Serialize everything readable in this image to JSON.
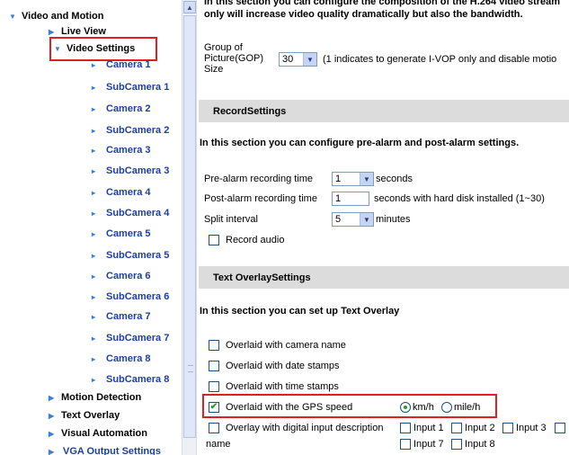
{
  "nav": {
    "video_and_motion": "Video and Motion",
    "live_view": "Live View",
    "video_settings": "Video Settings",
    "cameras": [
      "Camera 1",
      "SubCamera 1",
      "Camera 2",
      "SubCamera 2",
      "Camera 3",
      "SubCamera 3",
      "Camera 4",
      "SubCamera 4",
      "Camera 5",
      "SubCamera 5",
      "Camera 6",
      "SubCamera 6",
      "Camera 7",
      "SubCamera 7",
      "Camera 8",
      "SubCamera 8"
    ],
    "motion_detection": "Motion Detection",
    "text_overlay": "Text Overlay",
    "visual_automation": "Visual Automation",
    "vga_output_settings": "VGA Output Settings"
  },
  "main": {
    "intro_line1": "In this section you can configure the composition of the H.264 video stream",
    "intro_line2": "only will increase video quality dramatically but also the bandwidth.",
    "gop": {
      "label_line1": "Group of",
      "label_line2": "Picture(GOP)",
      "label_line3": "Size",
      "value": "30",
      "hint": "(1 indicates to generate I-VOP only and disable motio"
    },
    "record_settings": {
      "header": "RecordSettings",
      "description": "In this section you can configure pre-alarm and post-alarm settings.",
      "pre_alarm_label": "Pre-alarm recording time",
      "pre_alarm_value": "1",
      "pre_alarm_unit": "seconds",
      "post_alarm_label": "Post-alarm recording time",
      "post_alarm_value": "1",
      "post_alarm_unit": "seconds with hard disk installed (1~30)",
      "split_label": "Split interval",
      "split_value": "5",
      "split_unit": "minutes",
      "record_audio_label": "Record audio",
      "record_audio_checked": false
    },
    "text_overlay": {
      "header": "Text OverlaySettings",
      "description": "In this section you can set up Text Overlay",
      "camera_name_label": "Overlaid with camera name",
      "date_stamps_label": "Overlaid with date stamps",
      "time_stamps_label": "Overlaid with time stamps",
      "gps_speed_label": "Overlaid with the GPS speed",
      "gps_speed_checked": true,
      "unit_kmh": "km/h",
      "unit_mileh": "mile/h",
      "selected_unit": "km/h",
      "digital_input_label_line1": "Overlay with digital input description",
      "digital_input_label_line2": "name",
      "inputs_row1": [
        "Input 1",
        "Input 2",
        "Input 3"
      ],
      "inputs_row2": [
        "Input 7",
        "Input 8"
      ]
    }
  },
  "colors": {
    "highlight_border": "#e02020",
    "nav_link": "#1c3f9e",
    "tree_arrow": "#3a7fd5",
    "section_header_bg": "#dcdcdc",
    "check_mark": "#21a121"
  }
}
